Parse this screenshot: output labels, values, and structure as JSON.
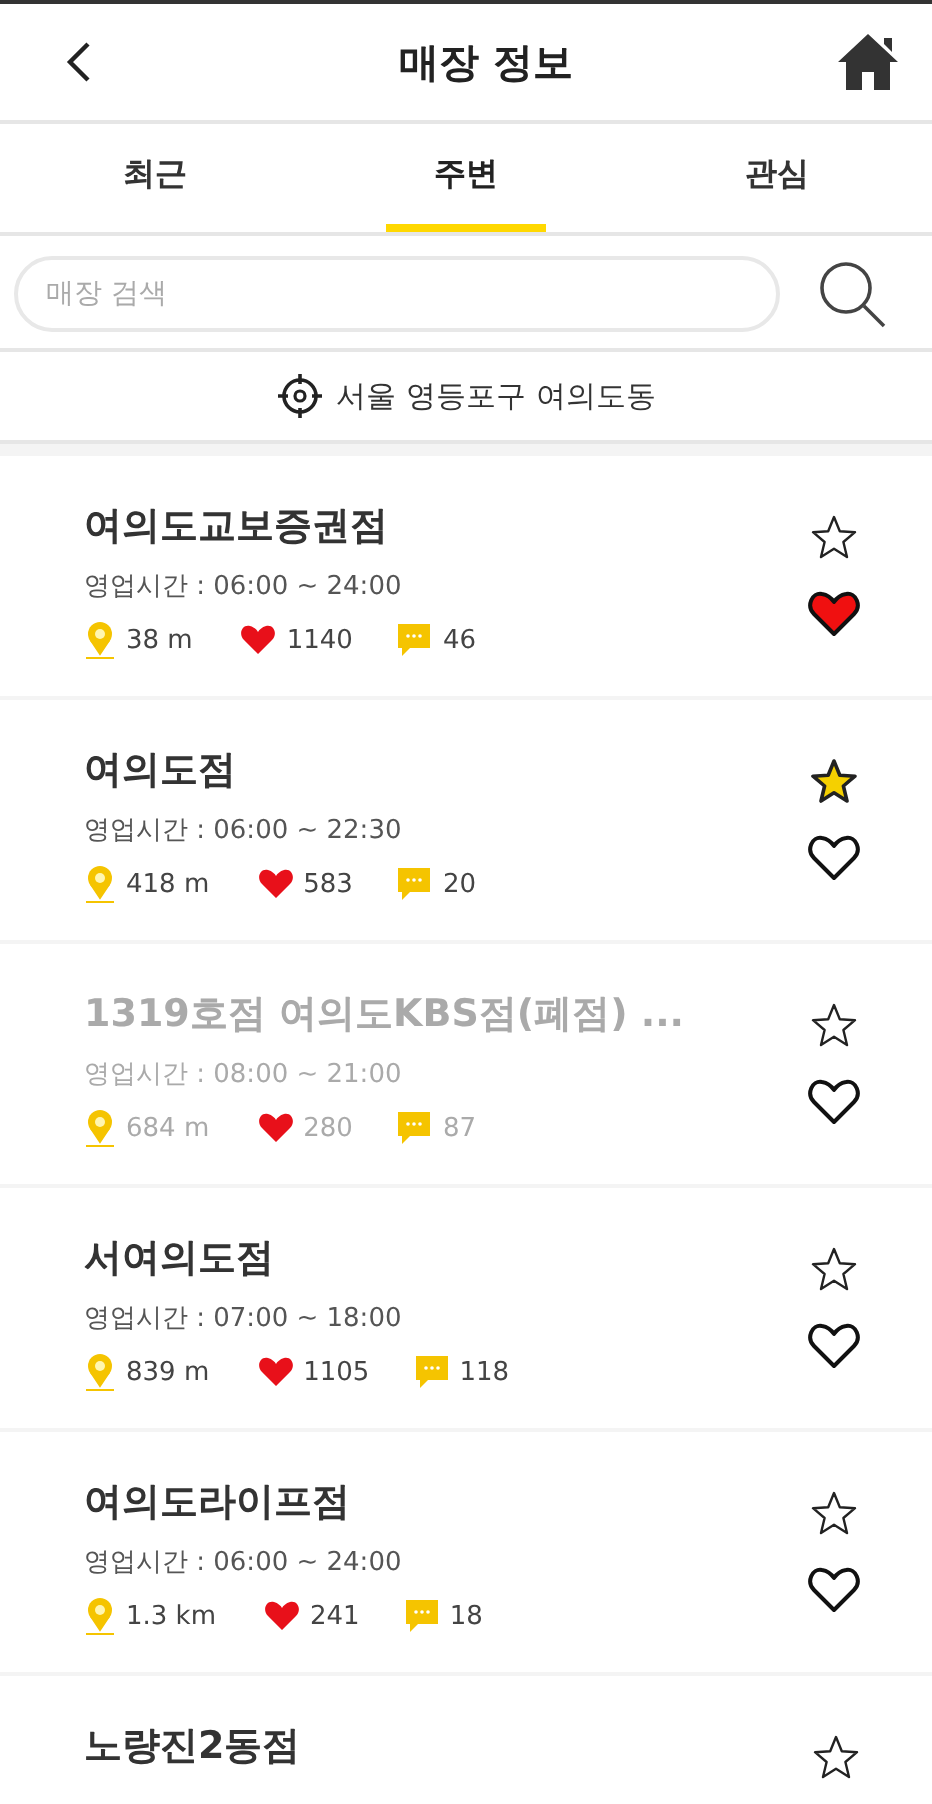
{
  "header": {
    "title": "매장 정보"
  },
  "tabs": [
    {
      "label": "최근",
      "selected": false
    },
    {
      "label": "주변",
      "selected": true
    },
    {
      "label": "관심",
      "selected": false
    }
  ],
  "search": {
    "placeholder": "매장 검색"
  },
  "location": "서울 영등포구 여의도동",
  "stores": [
    {
      "name": "여의도교보증권점",
      "hours": "영업시간 : 06:00 ~ 24:00",
      "distance": "38 m",
      "likes": "1140",
      "reviews": "46",
      "closed": false,
      "starred": false,
      "liked": true
    },
    {
      "name": "여의도점",
      "hours": "영업시간 : 06:00 ~ 22:30",
      "distance": "418 m",
      "likes": "583",
      "reviews": "20",
      "closed": false,
      "starred": true,
      "liked": false
    },
    {
      "name": "1319호점 여의도KBS점(폐점) ...",
      "hours": "영업시간 : 08:00 ~ 21:00",
      "distance": "684 m",
      "likes": "280",
      "reviews": "87",
      "closed": true,
      "starred": false,
      "liked": false
    },
    {
      "name": "서여의도점",
      "hours": "영업시간 : 07:00 ~ 18:00",
      "distance": "839 m",
      "likes": "1105",
      "reviews": "118",
      "closed": false,
      "starred": false,
      "liked": false
    },
    {
      "name": "여의도라이프점",
      "hours": "영업시간 : 06:00 ~ 24:00",
      "distance": "1.3 km",
      "likes": "241",
      "reviews": "18",
      "closed": false,
      "starred": false,
      "liked": false
    },
    {
      "name": "노량진2동점",
      "closed": false,
      "starred": false
    }
  ]
}
